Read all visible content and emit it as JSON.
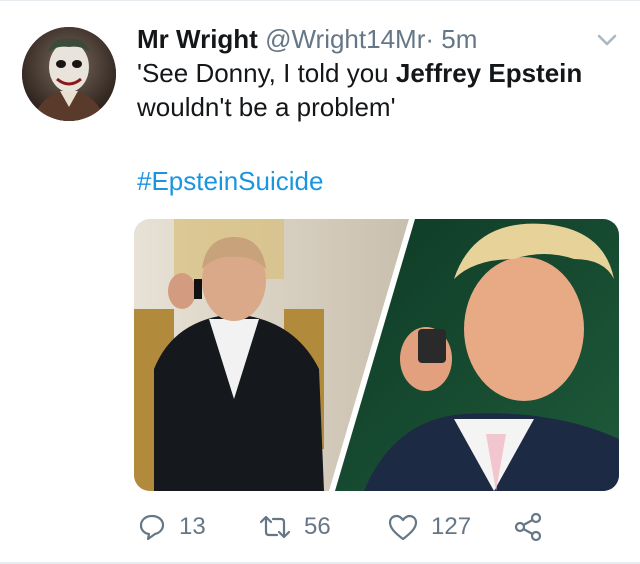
{
  "tweet": {
    "display_name": "Mr Wright",
    "handle": "@Wright14Mr",
    "separator": "·",
    "time": "5m",
    "text_part1": "'See Donny, I told you ",
    "text_bold": "Jeffrey Epstein",
    "text_part2": " wouldn't be a problem'",
    "hashtag": "#EpsteinSuicide"
  },
  "actions": {
    "reply_count": "13",
    "retweet_count": "56",
    "like_count": "127"
  },
  "icons": {
    "menu": "chevron-down-icon",
    "reply": "reply-icon",
    "retweet": "retweet-icon",
    "like": "heart-icon",
    "share": "share-icon"
  },
  "colors": {
    "link": "#1b95e0",
    "muted": "#657786",
    "text": "#14171a"
  }
}
